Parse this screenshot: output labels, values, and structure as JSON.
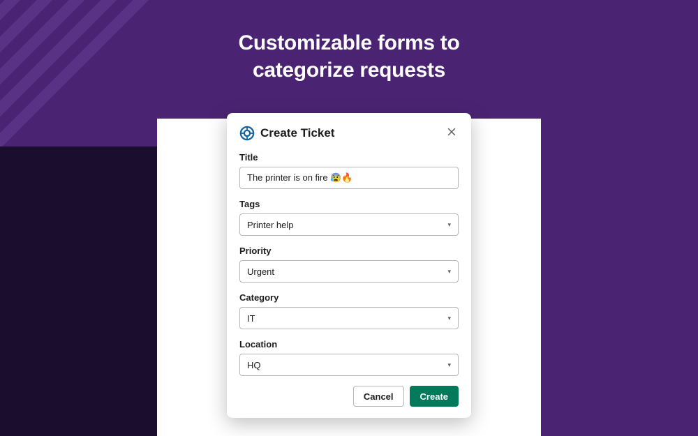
{
  "page": {
    "heading_line1": "Customizable forms to",
    "heading_line2": "categorize requests"
  },
  "modal": {
    "title": "Create Ticket",
    "fields": {
      "title": {
        "label": "Title",
        "value": "The printer is on fire 😰🔥"
      },
      "tags": {
        "label": "Tags",
        "value": "Printer help"
      },
      "priority": {
        "label": "Priority",
        "value": "Urgent"
      },
      "category": {
        "label": "Category",
        "value": "IT"
      },
      "location": {
        "label": "Location",
        "value": "HQ"
      }
    },
    "buttons": {
      "cancel": "Cancel",
      "create": "Create"
    }
  }
}
